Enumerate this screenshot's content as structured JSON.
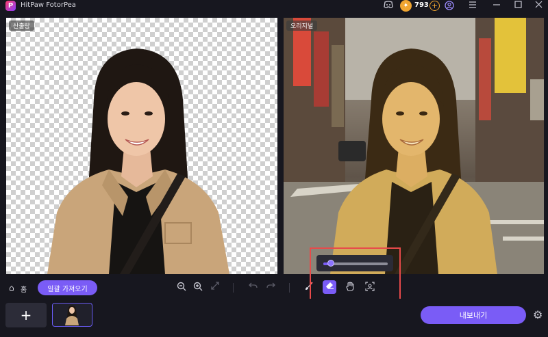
{
  "app": {
    "title": "HitPaw FotorPea",
    "logo_letter": "P"
  },
  "titlebar": {
    "credit_count": "793",
    "icons": [
      "discord-icon",
      "coin-avatar-icon",
      "add-credit-icon",
      "user-icon",
      "menu-icon",
      "minimize-icon",
      "maximize-icon",
      "close-icon"
    ]
  },
  "panels": {
    "left_label": "산출량",
    "right_label": "오리지널"
  },
  "toolbar": {
    "home_label": "홈",
    "batch_label": "일괄 가져오기",
    "brush_size_level": 0.12
  },
  "footer": {
    "add_label": "+",
    "export_label": "내보내기"
  },
  "colors": {
    "accent": "#7a5cf6",
    "highlight": "#e84a4a",
    "background": "#17171f",
    "credit": "#f0a531"
  }
}
